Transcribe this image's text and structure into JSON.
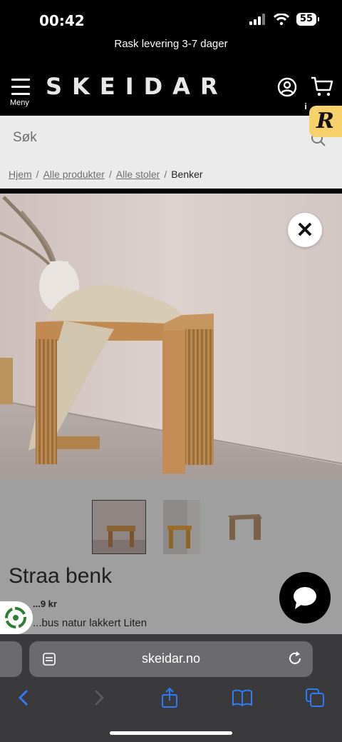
{
  "status": {
    "time": "00:42",
    "battery": "55"
  },
  "promo": {
    "text": "Rask levering 3-7 dager"
  },
  "header": {
    "logo": "SKEIDAR",
    "menu_label": "Meny"
  },
  "search": {
    "placeholder": "Søk"
  },
  "breadcrumb": {
    "items": [
      "Hjem",
      "Alle produkter",
      "Alle stoler"
    ],
    "separator": "/",
    "current": "Benker"
  },
  "product": {
    "title": "Straa benk",
    "price_partial": "...9 kr",
    "variant_partial": "...bus natur lakkert Liten"
  },
  "browser": {
    "url": "skeidar.no"
  },
  "colors": {
    "brand_black": "#000000",
    "badge_yellow": "#f7d26a",
    "safari_bar": "#3a3a3c"
  }
}
